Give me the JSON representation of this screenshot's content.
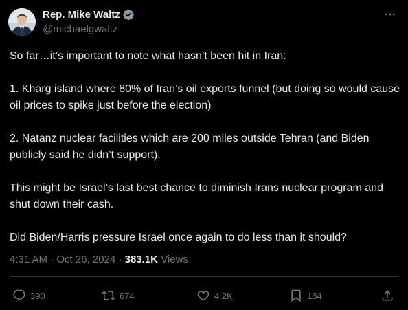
{
  "author": {
    "display_name": "Rep. Mike Waltz",
    "handle": "@michaelgwaltz",
    "verified": true
  },
  "body": {
    "paragraphs": [
      "So far…it’s important to note what hasn’t been hit in Iran:",
      "1. Kharg island where 80% of Iran’s oil exports funnel (but doing so would cause oil prices to spike just before the election)",
      "2. Natanz nuclear facilities which are 200 miles outside Tehran (and Biden publicly said he didn’t support).",
      "This might be Israel’s last best chance to diminish Irans nuclear program and shut down their cash.",
      "Did Biden/Harris pressure Israel once again to do less than it should?"
    ]
  },
  "meta": {
    "time": "4:31 AM",
    "separator": "·",
    "date": "Oct 26, 2024",
    "views_count": "383.1K",
    "views_label": "Views"
  },
  "actions": {
    "replies": "390",
    "reposts": "674",
    "likes": "4.2K",
    "bookmarks": "184"
  },
  "icons": {
    "verified": "verified-badge-icon",
    "more": "more-dots-icon",
    "reply": "reply-bubble-icon",
    "repost": "repost-arrows-icon",
    "like": "heart-icon",
    "bookmark": "bookmark-icon",
    "share": "share-upload-icon"
  },
  "colors": {
    "background": "#000000",
    "text": "#e7e9ea",
    "muted": "#71767b",
    "divider": "#2f3336",
    "verified_badge": "#829aab"
  }
}
